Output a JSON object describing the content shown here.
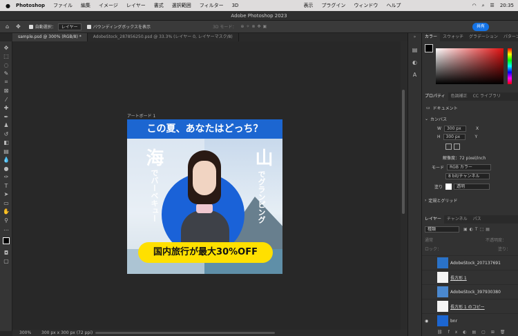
{
  "menubar": {
    "app": "Photoshop",
    "items": [
      "ファイル",
      "編集",
      "イメージ",
      "レイヤー",
      "書式",
      "選択範囲",
      "フィルター",
      "3D",
      "表示",
      "プラグイン",
      "ウィンドウ",
      "ヘルプ"
    ],
    "clock": "20:35"
  },
  "window": {
    "title": "Adobe Photoshop 2023"
  },
  "options": {
    "autoselect": "自動選択：",
    "autoselect_value": "レイヤー",
    "boundingbox": "バウンディングボックスを表示",
    "mode3d": "3D モード：",
    "share": "共有"
  },
  "tabs": [
    "sample.psd @ 300% (RGB/8) *",
    "AdobeStock_287856250.psd @ 33.3% (レイヤー 0, レイヤーマスク/8)"
  ],
  "artboard": {
    "label": "アートボード 1",
    "headline": "この夏、あなたはどっち？",
    "sea_big": "海",
    "sea_small": "でバーベキュー",
    "mountain_big": "山",
    "mountain_small": "でグランピング",
    "banner": "国内旅行が最大30%OFF"
  },
  "status": {
    "zoom": "300%",
    "info": "300 px x 300 px (72 ppi)"
  },
  "color_panel": {
    "tabs": [
      "カラー",
      "スウォッチ",
      "グラデーション",
      "パターン"
    ]
  },
  "properties_panel": {
    "tabs": [
      "プロパティ",
      "色調補正",
      "CC ライブラリ"
    ],
    "document": "ドキュメント",
    "canvas": "カンバス",
    "w_label": "W",
    "w": "300 px",
    "h_label": "H",
    "h": "300 px",
    "x_label": "X",
    "y_label": "Y",
    "resolution": "解像度：72 pixel/inch",
    "mode_label": "モード",
    "mode": "RGB カラー",
    "depth": "8 bit/チャンネル",
    "fill_label": "塗り",
    "fill": "透明",
    "guides": "定規とグリッド"
  },
  "layers_panel": {
    "tabs": [
      "レイヤー",
      "チャンネル",
      "パス"
    ],
    "filter": "種類",
    "blend": "通常",
    "opacity_label": "不透明度：",
    "lock_label": "ロック：",
    "fill_label": "塗り：",
    "layers": [
      {
        "name": "AdobeStock_207137691",
        "vis": false
      },
      {
        "name": "長方形 1",
        "vis": false
      },
      {
        "name": "AdobeStock_397930380",
        "vis": false
      },
      {
        "name": "長方形 1 のコピー",
        "vis": false
      },
      {
        "name": "bnr",
        "vis": true
      }
    ]
  }
}
